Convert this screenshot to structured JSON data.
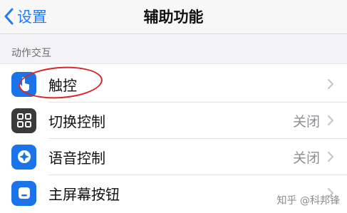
{
  "nav": {
    "back_label": "设置",
    "title": "辅助功能"
  },
  "section": {
    "header": "动作交互"
  },
  "rows": [
    {
      "label": "触控",
      "value": "",
      "icon": "hand-touch-icon",
      "icon_color": "#1a73e8"
    },
    {
      "label": "切换控制",
      "value": "关闭",
      "icon": "grid-icon",
      "icon_color": "#3a3a3c"
    },
    {
      "label": "语音控制",
      "value": "关闭",
      "icon": "speech-bubble-icon",
      "icon_color": "#1a73e8"
    },
    {
      "label": "主屏幕按钮",
      "value": "",
      "icon": "home-button-icon",
      "icon_color": "#1a73e8"
    }
  ],
  "annotation": {
    "highlight_color": "#d9262c"
  },
  "watermark": "知乎 @科邦锋",
  "colors": {
    "accent": "#1f7bf6",
    "background": "#f2f2f7"
  }
}
